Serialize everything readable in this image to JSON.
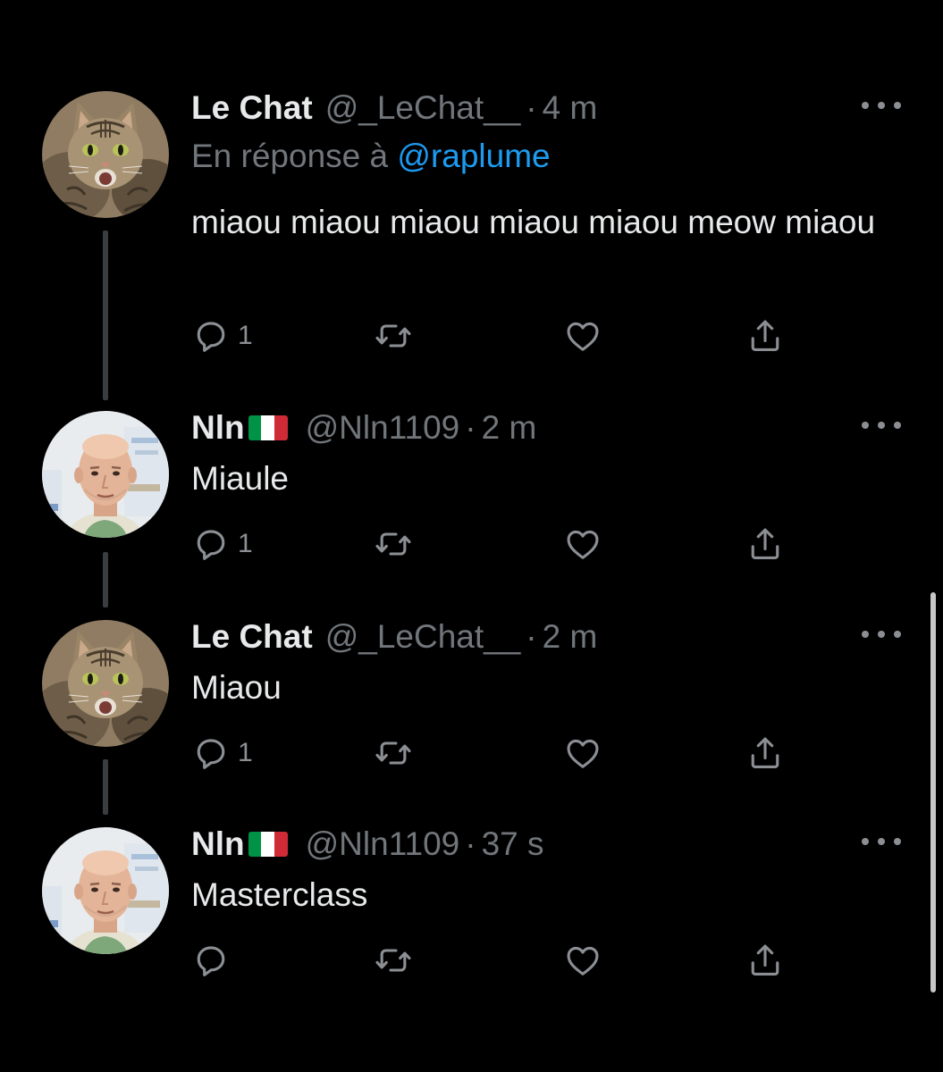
{
  "tweets": [
    {
      "name": "Le Chat",
      "handle": "@_LeChat__",
      "sep": "·",
      "time": "4 m",
      "reply_prefix": "En réponse à",
      "reply_mention": "@raplume",
      "text": "miaou miaou miaou miaou miaou meow miaou",
      "reply_count": "1",
      "avatar": "cat-avatar"
    },
    {
      "name": "Nln",
      "flag": "italy-flag",
      "handle": "@Nln1109",
      "sep": "·",
      "time": "2 m",
      "text": "Miaule",
      "reply_count": "1",
      "avatar": "bald-man-avatar"
    },
    {
      "name": "Le Chat",
      "handle": "@_LeChat__",
      "sep": "·",
      "time": "2 m",
      "text": "Miaou",
      "reply_count": "1",
      "avatar": "cat-avatar"
    },
    {
      "name": "Nln",
      "flag": "italy-flag",
      "handle": "@Nln1109",
      "sep": "·",
      "time": "37 s",
      "text": "Masterclass",
      "reply_count": "",
      "avatar": "bald-man-avatar"
    }
  ],
  "icons": {
    "reply": "reply-icon",
    "retweet": "retweet-icon",
    "like": "heart-icon",
    "share": "share-icon",
    "more": "more-icon"
  },
  "colors": {
    "background": "#000000",
    "text": "#e7e9ea",
    "secondary": "#71767b",
    "link": "#1d9bf0",
    "flag_green": "#009246",
    "flag_white": "#ffffff",
    "flag_red": "#ce2b37"
  }
}
